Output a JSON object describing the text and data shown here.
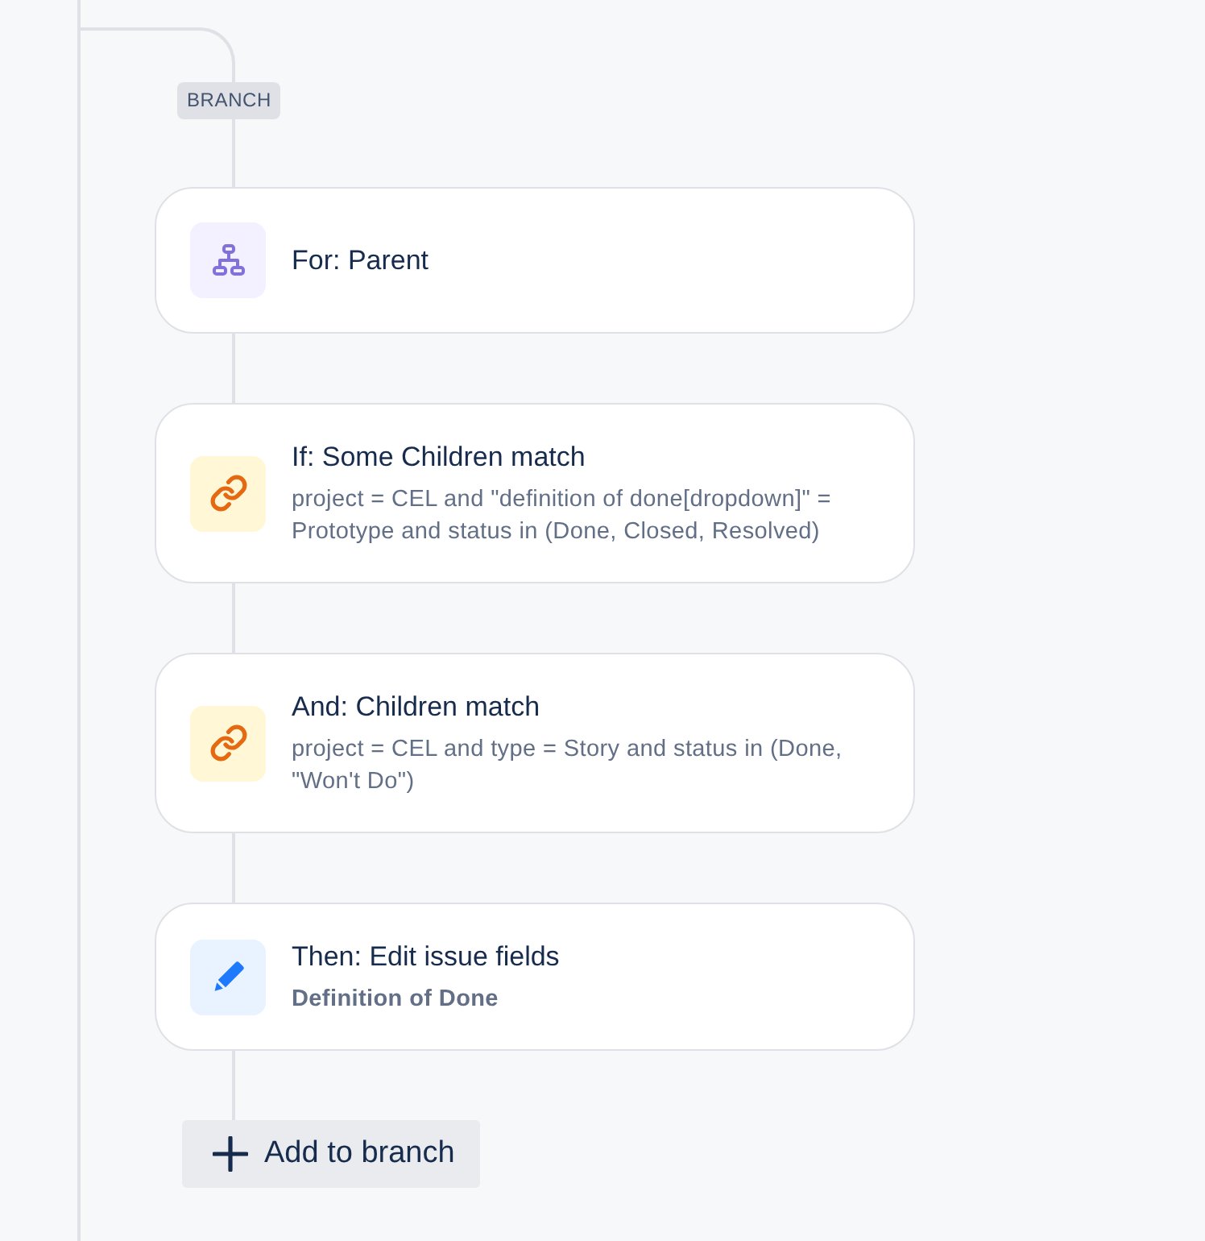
{
  "branch_label": "BRANCH",
  "steps": [
    {
      "kind": "branch",
      "title": "For: Parent"
    },
    {
      "kind": "condition",
      "title": "If: Some Children match",
      "description": "project = CEL and \"definition of done[dropdown]\" = Prototype and status in (Done, Closed, Resolved)"
    },
    {
      "kind": "condition",
      "title": "And: Children match",
      "description": "project = CEL and type = Story and status in (Done, \"Won't Do\")"
    },
    {
      "kind": "action",
      "title": "Then: Edit issue fields",
      "description": "Definition of Done"
    }
  ],
  "add_button": {
    "label": "Add to branch"
  }
}
